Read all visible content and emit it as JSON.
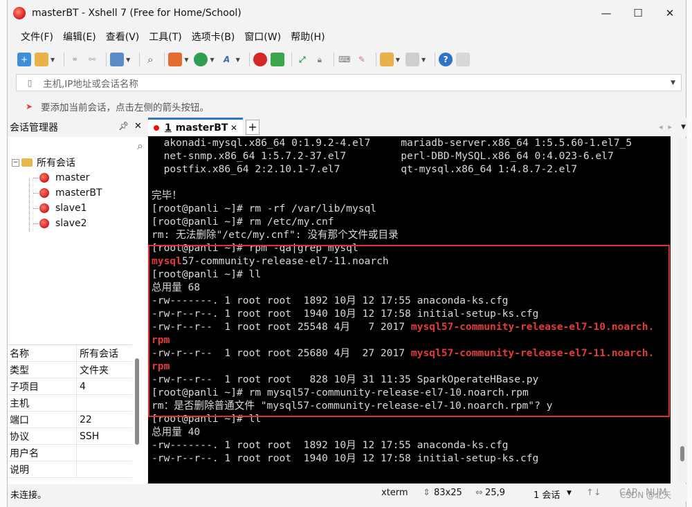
{
  "window": {
    "title": "masterBT - Xshell 7 (Free for Home/School)",
    "controls": [
      "—",
      "☐",
      "✕"
    ]
  },
  "menu": [
    "文件(F)",
    "编辑(E)",
    "查看(V)",
    "工具(T)",
    "选项卡(B)",
    "窗口(W)",
    "帮助(H)"
  ],
  "address": {
    "placeholder": "主机,IP地址或会话名称"
  },
  "hint": {
    "text": "要添加当前会话，点击左侧的箭头按钮。"
  },
  "session_manager": {
    "title": "会话管理器",
    "root": "所有会话",
    "sessions": [
      "master",
      "masterBT",
      "slave1",
      "slave2"
    ]
  },
  "properties": [
    {
      "k": "名称",
      "v": "所有会话"
    },
    {
      "k": "类型",
      "v": "文件夹"
    },
    {
      "k": "子项目",
      "v": "4"
    },
    {
      "k": "主机",
      "v": ""
    },
    {
      "k": "端口",
      "v": "22"
    },
    {
      "k": "协议",
      "v": "SSH"
    },
    {
      "k": "用户名",
      "v": ""
    },
    {
      "k": "说明",
      "v": ""
    }
  ],
  "tab": {
    "num": "1",
    "label": "masterBT"
  },
  "terminal": {
    "lines": [
      [
        {
          "t": "  akonadi-mysql.x86_64 0:1.9.2-4.el7     mariadb-server.x86_64 1:5.5.60-1.el7_5"
        }
      ],
      [
        {
          "t": "  net-snmp.x86_64 1:5.7.2-37.el7         perl-DBD-MySQL.x86_64 0:4.023-6.el7"
        }
      ],
      [
        {
          "t": "  postfix.x86_64 2:2.10.1-7.el7          qt-mysql.x86_64 1:4.8.7-2.el7"
        }
      ],
      [
        {
          "t": ""
        }
      ],
      [
        {
          "t": "完毕！"
        }
      ],
      [
        {
          "t": "[root@panli ~]# rm -rf /var/lib/mysql"
        }
      ],
      [
        {
          "t": "[root@panli ~]# rm /etc/my.cnf"
        }
      ],
      [
        {
          "t": "rm: 无法删除\"/etc/my.cnf\": 没有那个文件或目录"
        }
      ],
      [
        {
          "t": "[root@panli ~]# rpm -qa|grep mysql"
        }
      ],
      [
        {
          "t": "mysql",
          "red": true
        },
        {
          "t": "57-community-release-el7-11.noarch"
        }
      ],
      [
        {
          "t": "[root@panli ~]# ll"
        }
      ],
      [
        {
          "t": "总用量 68"
        }
      ],
      [
        {
          "t": "-rw-------. 1 root root  1892 10月 12 17:55 anaconda-ks.cfg"
        }
      ],
      [
        {
          "t": "-rw-r--r--. 1 root root  1940 10月 12 17:58 initial-setup-ks.cfg"
        }
      ],
      [
        {
          "t": "-rw-r--r--  1 root root 25548 4月   7 2017 "
        },
        {
          "t": "mysql57-community-release-el7-10.noarch.",
          "red": true
        }
      ],
      [
        {
          "t": "rpm",
          "red": true
        }
      ],
      [
        {
          "t": "-rw-r--r--  1 root root 25680 4月  27 2017 "
        },
        {
          "t": "mysql57-community-release-el7-11.noarch.",
          "red": true
        }
      ],
      [
        {
          "t": "rpm",
          "red": true
        }
      ],
      [
        {
          "t": "-rw-r--r--  1 root root   828 10月 31 11:35 SparkOperateHBase.py"
        }
      ],
      [
        {
          "t": "[root@panli ~]# rm mysql57-community-release-el7-10.noarch.rpm"
        }
      ],
      [
        {
          "t": "rm：是否删除普通文件 \"mysql57-community-release-el7-10.noarch.rpm\"? y"
        }
      ],
      [
        {
          "t": "[root@panli ~]# ll"
        }
      ],
      [
        {
          "t": "总用量 40"
        }
      ],
      [
        {
          "t": "-rw-------. 1 root root  1892 10月 12 17:55 anaconda-ks.cfg"
        }
      ],
      [
        {
          "t": "-rw-r--r--. 1 root root  1940 10月 12 17:58 initial-setup-ks.cfg"
        }
      ]
    ]
  },
  "status": {
    "connection": "未连接。",
    "term": "xterm",
    "size": "83x25",
    "cursor": "25,9",
    "sessions": "1 会话",
    "caps": "CAP",
    "num": "NUM"
  },
  "watermark": "CSDN @北天"
}
